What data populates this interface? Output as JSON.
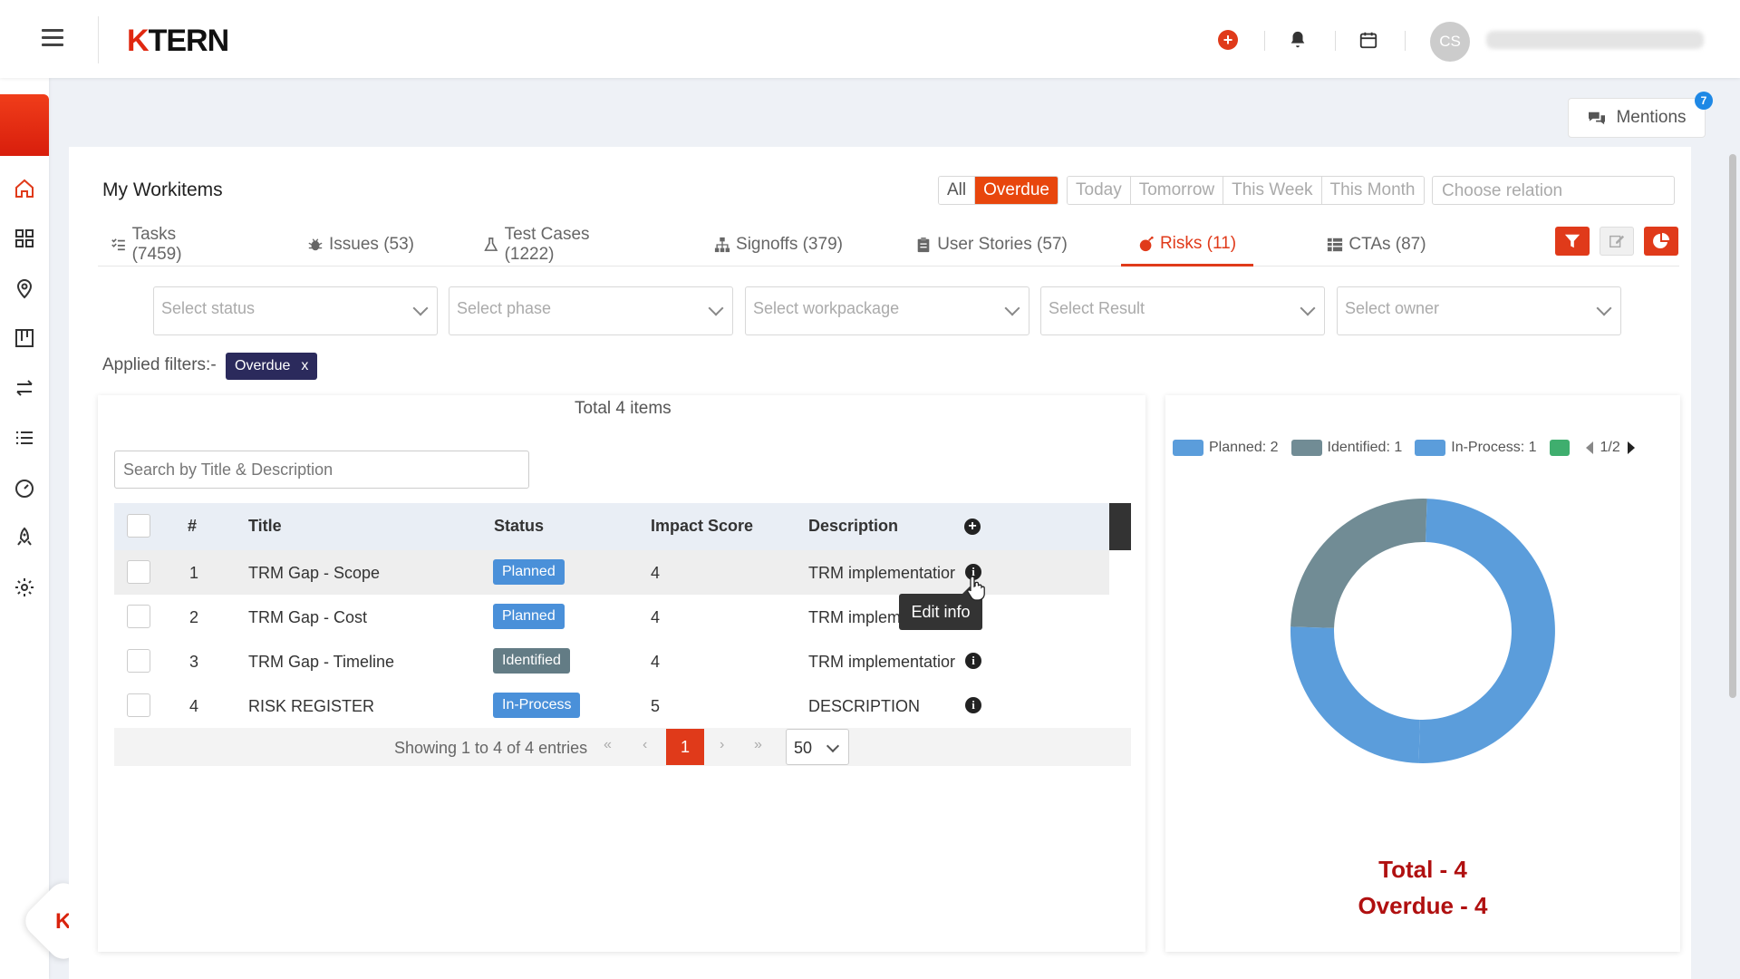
{
  "header": {
    "logo": "KTERN",
    "avatar_initials": "CS",
    "icons": [
      "hamburger-icon",
      "add-icon",
      "bell-icon",
      "calendar-icon"
    ]
  },
  "sidebar": {
    "items": [
      "home-icon",
      "dashboard-icon",
      "location-icon",
      "board-icon",
      "transfer-icon",
      "list-icon",
      "gauge-icon",
      "rocket-icon",
      "settings-icon"
    ]
  },
  "mentions": {
    "label": "Mentions",
    "count": "7"
  },
  "workitems": {
    "title": "My Workitems",
    "relation_filters": [
      "All",
      "Overdue"
    ],
    "time_filters": [
      "Today",
      "Tomorrow",
      "This Week",
      "This Month"
    ],
    "choose_relation_placeholder": "Choose relation",
    "tabs": [
      {
        "label": "Tasks (7459)",
        "icon": "tasks-icon"
      },
      {
        "label": "Issues (53)",
        "icon": "bug-icon"
      },
      {
        "label": "Test Cases (1222)",
        "icon": "flask-icon"
      },
      {
        "label": "Signoffs (379)",
        "icon": "hierarchy-icon"
      },
      {
        "label": "User Stories (57)",
        "icon": "clipboard-icon"
      },
      {
        "label": "Risks (11)",
        "icon": "bomb-icon"
      },
      {
        "label": "CTAs (87)",
        "icon": "table-icon"
      }
    ],
    "selects": [
      "Select status",
      "Select phase",
      "Select workpackage",
      "Select Result",
      "Select owner"
    ],
    "applied_filters_label": "Applied filters:-",
    "applied_chip": "Overdue",
    "chip_close": "x"
  },
  "table": {
    "total_label": "Total 4 items",
    "search_placeholder": "Search by Title & Description",
    "headers": [
      "#",
      "Title",
      "Status",
      "Impact Score",
      "Description"
    ],
    "rows": [
      {
        "num": "1",
        "title": "TRM Gap - Scope",
        "status": "Planned",
        "impact": "4",
        "description": "TRM implementatior"
      },
      {
        "num": "2",
        "title": "TRM Gap - Cost",
        "status": "Planned",
        "impact": "4",
        "description": "TRM implementatior"
      },
      {
        "num": "3",
        "title": "TRM Gap - Timeline",
        "status": "Identified",
        "impact": "4",
        "description": "TRM implementatior"
      },
      {
        "num": "4",
        "title": "RISK REGISTER",
        "status": "In-Process",
        "impact": "5",
        "description": "DESCRIPTION"
      }
    ],
    "tooltip": "Edit info",
    "footer_text": "Showing 1 to 4 of 4 entries",
    "pagination": {
      "first": "«",
      "prev": "‹",
      "current": "1",
      "next": "›",
      "last": "»"
    },
    "page_size": "50"
  },
  "chart": {
    "legend_page": "1/2",
    "total_label": "Total - 4",
    "overdue_label": "Overdue - 4"
  },
  "chart_data": {
    "type": "pie",
    "style": "donut",
    "categories": [
      "Planned",
      "Identified",
      "In-Process"
    ],
    "values": [
      2,
      1,
      1
    ],
    "legend": [
      "Planned: 2",
      "Identified: 1",
      "In-Process: 1"
    ],
    "colors": [
      "#5b9ddb",
      "#718c95",
      "#5b9ddb",
      "#3fae6e"
    ],
    "legend_position": "top"
  }
}
